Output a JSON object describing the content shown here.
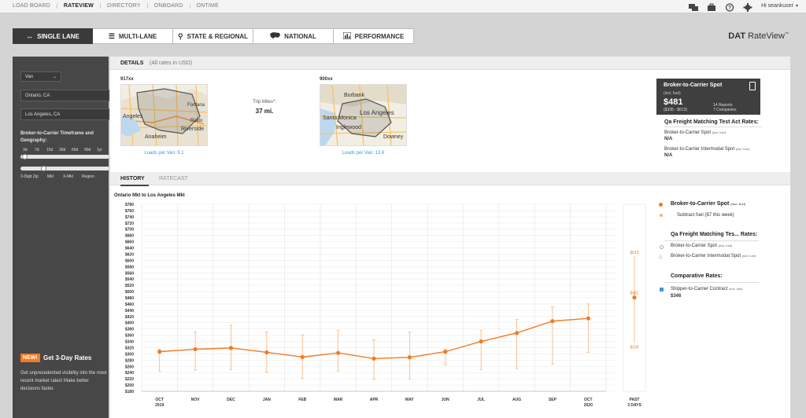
{
  "topnav": {
    "links": [
      "LOAD BOARD",
      "RATEVIEW",
      "DIRECTORY",
      "ONBOARD",
      "ONTIME"
    ],
    "active": "RATEVIEW",
    "user_greeting": "Hi seankuser"
  },
  "tabs": [
    {
      "label": "SINGLE LANE",
      "icon": "arrows-horizontal-icon",
      "active": true
    },
    {
      "label": "MULTI-LANE",
      "icon": "grid-list-icon",
      "active": false
    },
    {
      "label": "STATE & REGIONAL",
      "icon": "map-pin-icon",
      "active": false
    },
    {
      "label": "NATIONAL",
      "icon": "usa-map-icon",
      "active": false
    },
    {
      "label": "PERFORMANCE",
      "icon": "bar-chart-icon",
      "active": false
    }
  ],
  "brand": {
    "prefix": "DAT",
    "name": "RateView"
  },
  "sidebar": {
    "equipment": "Van",
    "origin": "Ontario, CA",
    "destination": "Los Angeles, CA",
    "timeframe_label": "Broker-to-Carrier Timeframe and Geography:",
    "timeframe_ticks": [
      "3d",
      "7d",
      "15d",
      "30d",
      "60d",
      "90d",
      "1yr"
    ],
    "geo_ticks": [
      "3-Digit Zip",
      "Mkt",
      "X-Mkt",
      "Region"
    ],
    "timeframe_selected": "3d",
    "geo_selected": "Mkt",
    "promo_badge": "NEW!",
    "promo_title": "Get 3-Day Rates",
    "promo_text": "Get unprecedented visibility into the most recent market rates! Make better decisions faster."
  },
  "details": {
    "title": "DETAILS",
    "subtitle": "(All rates in USD)",
    "origin_code": "917xx",
    "dest_code": "900xx",
    "origin_loads": "Loads per Van: 9.1",
    "dest_loads": "Loads per Van: 13.6",
    "trip_label": "Trip Miles*:",
    "trip_value": "37 mi.",
    "origin_map_labels": [
      "Fontana",
      "Rialto",
      "Riverside",
      "Anaheim",
      "Angeles"
    ],
    "dest_map_labels": [
      "Burbank",
      "Los Angeles",
      "Santa Monica",
      "Inglewood",
      "Downey"
    ]
  },
  "spot_card": {
    "title": "Broker-to-Carrier Spot",
    "subtitle": "(incl. fuel)",
    "value": "$481",
    "range": "($335 - $613)",
    "reports": "14 Reports",
    "companies": "7 Companies"
  },
  "qa_rates": {
    "title": "Qa Freight Matching Test Act Rates:",
    "spot_label": "Broker-to-Carrier Spot",
    "spot_note": "(incl. fuel)",
    "spot_value": "N/A",
    "intermodal_label": "Broker-to-Carrier Intermodal Spot",
    "intermodal_note": "(incl. fuel)",
    "intermodal_value": "N/A"
  },
  "history": {
    "tabs": [
      "HISTORY",
      "RATECAST"
    ],
    "chart_title": "Ontario Mkt to Los Angeles Mkt"
  },
  "legend": {
    "spot": "Broker-to-Carrier Spot",
    "spot_note": "(incl. fuel)",
    "subtract": "Subtract fuel ($7 this week)",
    "qa_title": "Qa Freight Matching Tes... Rates:",
    "qa_spot": "Broker-to-Carrier Spot",
    "qa_spot_note": "(incl. fuel)",
    "qa_inter": "Broker-to-Carrier Intermodal Spot",
    "qa_inter_note": "(incl. fuel)",
    "comp_title": "Comparative Rates:",
    "contract": "Shipper-to-Carrier Contract",
    "contract_note": "(incl. fuel)",
    "contract_value": "$346"
  },
  "colors": {
    "accent": "#f47a20",
    "dark": "#3f3f3f",
    "link": "#3a9ad9"
  },
  "chart_data": {
    "type": "line",
    "categories": [
      "OCT\n2019",
      "NOV",
      "DEC",
      "JAN",
      "FEB",
      "MAR",
      "APR",
      "MAY",
      "JUN",
      "JUL",
      "AUG",
      "SEP",
      "OCT\n2020"
    ],
    "y_ticks": [
      "$180",
      "$200",
      "$220",
      "$240",
      "$260",
      "$280",
      "$300",
      "$320",
      "$340",
      "$360",
      "$380",
      "$400",
      "$420",
      "$440",
      "$460",
      "$480",
      "$500",
      "$520",
      "$540",
      "$560",
      "$580",
      "$600",
      "$620",
      "$640",
      "$660",
      "$680",
      "$700",
      "$720",
      "$740",
      "$760",
      "$780"
    ],
    "ylim": [
      180,
      780
    ],
    "series": [
      {
        "name": "Broker-to-Carrier Spot",
        "values": [
          307,
          315,
          319,
          305,
          290,
          303,
          285,
          289,
          307,
          340,
          367,
          405,
          414
        ],
        "low": [
          245,
          248,
          250,
          241,
          221,
          245,
          218,
          220,
          265,
          250,
          253,
          268,
          305
        ],
        "high": [
          315,
          370,
          392,
          370,
          360,
          375,
          345,
          370,
          315,
          375,
          410,
          450,
          460
        ]
      }
    ],
    "past": {
      "label": "PAST\n3 DAYS",
      "value": 481,
      "low": 335,
      "high": 613,
      "low_label": "$335",
      "high_label": "$613",
      "value_label": "$481"
    }
  }
}
